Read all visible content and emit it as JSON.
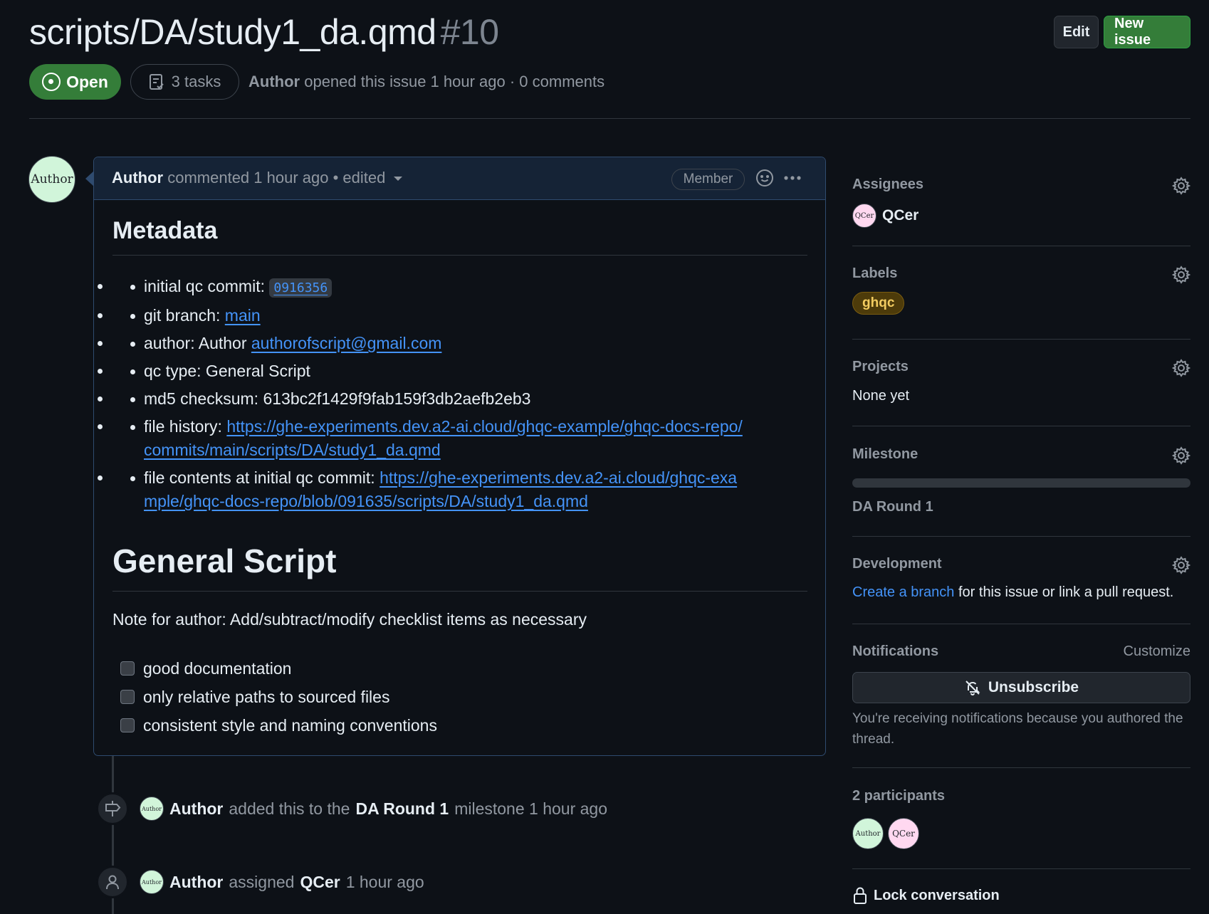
{
  "header": {
    "title": "scripts/DA/study1_da.qmd",
    "number": "#10",
    "edit_label": "Edit",
    "new_issue_label": "New issue",
    "state": "Open",
    "tasks": "3 tasks",
    "author": "Author",
    "meta_text": "opened this issue 1 hour ago · 0 comments"
  },
  "comment": {
    "avatar_text": "Author",
    "author": "Author",
    "meta": "commented 1 hour ago • edited",
    "badge": "Member",
    "metadata_heading": "Metadata",
    "items": {
      "commit_label": "initial qc commit:",
      "commit_value": "0916356",
      "branch_label": "git branch:",
      "branch_value": "main",
      "author_label": "author: Author",
      "author_email": "authorofscript@gmail.com",
      "qc_type": "qc type: General Script",
      "md5": "md5 checksum: 613bc2f1429f9fab159f3db2aefb2eb3",
      "history_label": "file history:",
      "history_url": "https://ghe-experiments.dev.a2-ai.cloud/ghqc-example/ghqc-docs-repo/commits/main/scripts/DA/study1_da.qmd",
      "contents_label": "file contents at initial qc commit:",
      "contents_url": "https://ghe-experiments.dev.a2-ai.cloud/ghqc-example/ghqc-docs-repo/blob/091635/scripts/DA/study1_da.qmd"
    },
    "section_heading": "General Script",
    "note": "Note for author: Add/subtract/modify checklist items as necessary",
    "checklist": [
      "good documentation",
      "only relative paths to sourced files",
      "consistent style and naming conventions"
    ]
  },
  "events": [
    {
      "icon": "milestone-icon",
      "avatar": "Author",
      "actor": "Author",
      "pre": "added this to the",
      "target": "DA Round 1",
      "post": "milestone 1 hour ago"
    },
    {
      "icon": "person-icon",
      "avatar": "Author",
      "actor": "Author",
      "pre": "assigned",
      "target": "QCer",
      "post": "1 hour ago"
    }
  ],
  "sidebar": {
    "assignees": {
      "heading": "Assignees",
      "avatar": "QCer",
      "name": "QCer"
    },
    "labels": {
      "heading": "Labels",
      "chip": "ghqc",
      "chip_color": "#f2cc60"
    },
    "projects": {
      "heading": "Projects",
      "value": "None yet"
    },
    "milestone": {
      "heading": "Milestone",
      "progress": 0,
      "name": "DA Round 1"
    },
    "development": {
      "heading": "Development",
      "link": "Create a branch",
      "text": "for this issue or link a pull request."
    },
    "notifications": {
      "heading": "Notifications",
      "customize": "Customize",
      "button": "Unsubscribe",
      "reason": "You're receiving notifications because you authored the thread."
    },
    "participants": {
      "heading": "2 participants",
      "avatars": [
        "Author",
        "QCer"
      ]
    },
    "lock": "Lock conversation"
  },
  "colors": {
    "accent": "#4493f8",
    "open_green": "#347d39",
    "bg": "#0d1117"
  }
}
